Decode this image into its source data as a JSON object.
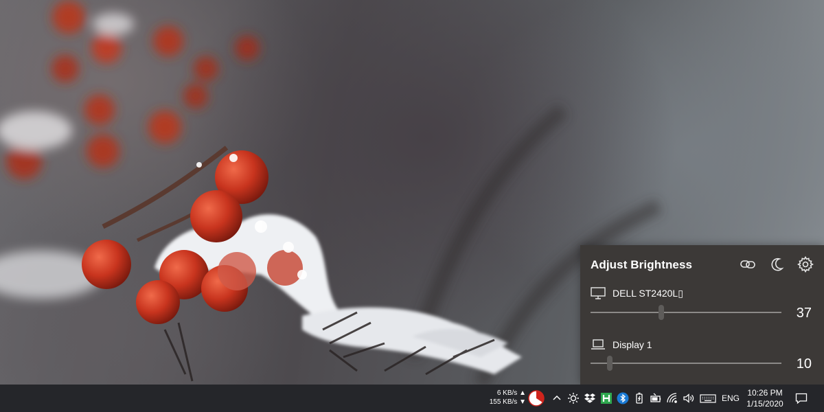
{
  "flyout": {
    "title": "Adjust Brightness",
    "header_icons": [
      "link-icon",
      "moon-icon",
      "gear-icon"
    ],
    "monitors": [
      {
        "name": "DELL ST2420L▯",
        "icon": "desktop-monitor-icon",
        "brightness": 37,
        "brightness_fraction": 0.37
      },
      {
        "name": "Display 1",
        "icon": "laptop-icon",
        "brightness": 10,
        "brightness_fraction": 0.1
      }
    ]
  },
  "taskbar": {
    "network_speed": {
      "upload": "6 KB/s",
      "download": "155 KB/s"
    },
    "tray_icons": [
      "pie-chart-icon",
      "chevron-up-icon",
      "brightness-sun-icon",
      "dropbox-icon",
      "hwinfo-icon",
      "bluetooth-icon",
      "battery-monitor-icon",
      "battery-icon",
      "wifi-icon",
      "volume-icon",
      "keyboard-icon"
    ],
    "language": "ENG",
    "time": "10:26 PM",
    "date": "1/15/2020",
    "notification_icon": "action-center-icon"
  },
  "colors": {
    "flyout_bg": "#3c3937",
    "taskbar_bg": "#25262a",
    "slider_track": "#8c8a88",
    "slider_thumb": "#5e5c5a",
    "berry_red": "#c8341e"
  }
}
